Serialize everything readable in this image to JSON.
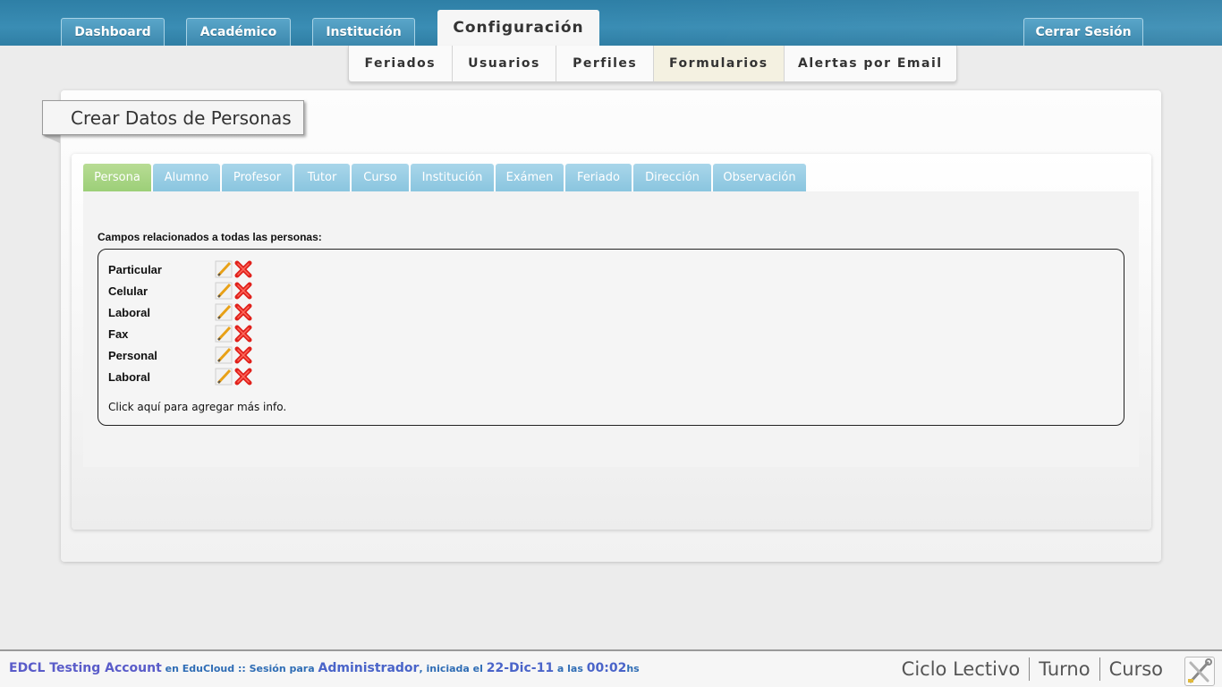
{
  "header": {
    "tabs": [
      {
        "label": "Dashboard"
      },
      {
        "label": "Académico"
      },
      {
        "label": "Institución"
      },
      {
        "label": "Configuración"
      }
    ],
    "logout_label": "Cerrar Sesión"
  },
  "subnav": {
    "items": [
      {
        "label": "Feriados"
      },
      {
        "label": "Usuarios"
      },
      {
        "label": "Perfiles"
      },
      {
        "label": "Formularios"
      },
      {
        "label": "Alertas por Email"
      }
    ],
    "active": "Formularios"
  },
  "page": {
    "title": "Crear Datos de Personas"
  },
  "form_tabs": {
    "items": [
      {
        "label": "Persona"
      },
      {
        "label": "Alumno"
      },
      {
        "label": "Profesor"
      },
      {
        "label": "Tutor"
      },
      {
        "label": "Curso"
      },
      {
        "label": "Institución"
      },
      {
        "label": "Exámen"
      },
      {
        "label": "Feriado"
      },
      {
        "label": "Dirección"
      },
      {
        "label": "Observación"
      }
    ],
    "active": "Persona"
  },
  "fields": {
    "section_label": "Campos relacionados a todas las personas:",
    "rows": [
      {
        "name": "Particular"
      },
      {
        "name": "Celular"
      },
      {
        "name": "Laboral"
      },
      {
        "name": "Fax"
      },
      {
        "name": "Personal"
      },
      {
        "name": "Laboral"
      }
    ],
    "add_more_label": "Click aquí para agregar más info."
  },
  "footer": {
    "account_name": "EDCL Testing Account",
    "text_en": "en",
    "platform": "EduCloud",
    "text_session": ":: Sesión para",
    "user_role": "Administrador",
    "text_started": ", iniciada el",
    "date": "22-Dic-11",
    "text_at": "a las",
    "time": "00:02",
    "time_suffix": "hs",
    "nav": [
      {
        "label": "Ciclo Lectivo"
      },
      {
        "label": "Turno"
      },
      {
        "label": "Curso"
      }
    ]
  },
  "icons": {
    "edit": "pencil-icon",
    "delete": "red-x-delete-icon",
    "tools": "tools-icon"
  },
  "colors": {
    "header_blue": "#3a8db4",
    "tab_blue": "#8ac5df",
    "tab_active_green": "#9ccf78",
    "delete_red": "#e0201b"
  }
}
